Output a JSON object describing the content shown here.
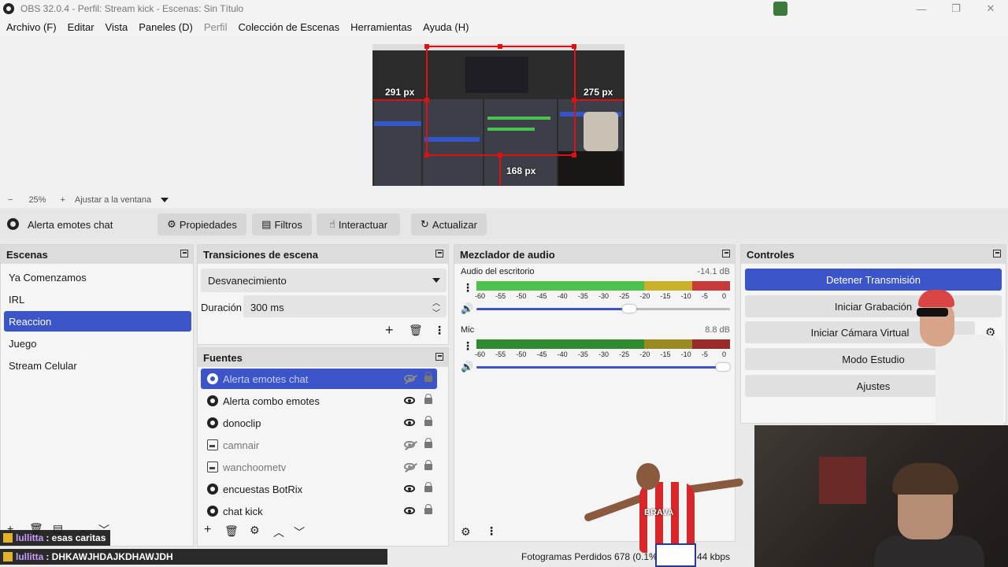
{
  "window": {
    "title": "OBS 32.0.4 - Perfil: Stream kick - Escenas: Sin Título",
    "controls": [
      "—",
      "❐",
      "✕"
    ]
  },
  "menu": [
    "Archivo (F)",
    "Editar",
    "Vista",
    "Paneles (D)",
    "Perfil",
    "Colección de Escenas",
    "Herramientas",
    "Ayuda (H)"
  ],
  "preview": {
    "labels": [
      "291 px",
      "275 px",
      "168 px"
    ]
  },
  "zoom": {
    "minus": "−",
    "level": "25%",
    "plus": "+",
    "fit": "Ajustar a la ventana"
  },
  "source_bar": {
    "current_source": "Alerta emotes chat",
    "properties": "Propiedades",
    "filters": "Filtros",
    "interact": "Interactuar",
    "refresh": "Actualizar"
  },
  "scenes": {
    "title": "Escenas",
    "items": [
      "Ya Comenzamos",
      "IRL",
      "Reaccion",
      "Juego",
      "Stream Celular"
    ],
    "selected_index": 2
  },
  "transitions": {
    "title": "Transiciones de escena",
    "selected": "Desvanecimiento",
    "duration_label": "Duración",
    "duration_value": "300 ms"
  },
  "sources": {
    "title": "Fuentes",
    "items": [
      {
        "label": "Alerta emotes chat",
        "type": "browser",
        "visible": false,
        "selected": true
      },
      {
        "label": "Alerta combo emotes",
        "type": "browser",
        "visible": true,
        "selected": false
      },
      {
        "label": "donoclip",
        "type": "browser",
        "visible": true,
        "selected": false
      },
      {
        "label": "camnair",
        "type": "image",
        "visible": false,
        "selected": false
      },
      {
        "label": "wanchoometv",
        "type": "image",
        "visible": false,
        "selected": false
      },
      {
        "label": "encuestas BotRix",
        "type": "browser",
        "visible": true,
        "selected": false
      },
      {
        "label": "chat kick",
        "type": "browser",
        "visible": true,
        "selected": false
      }
    ]
  },
  "mixer": {
    "title": "Mezclador de audio",
    "channels": [
      {
        "name": "Audio del escritorio",
        "db": "-14.1 dB",
        "volume": 0.63
      },
      {
        "name": "Mic",
        "db": "8.8 dB",
        "volume": 1.0
      }
    ],
    "scale": [
      "-60",
      "-55",
      "-50",
      "-45",
      "-40",
      "-35",
      "-30",
      "-25",
      "-20",
      "-15",
      "-10",
      "-5",
      "0"
    ]
  },
  "controls": {
    "title": "Controles",
    "buttons": [
      "Detener Transmisión",
      "Iniciar Grabación",
      "Iniciar Cámara Virtual",
      "Modo Estudio",
      "Ajustes"
    ]
  },
  "chat": [
    {
      "user": "lullitta",
      "message": ": esas caritas"
    },
    {
      "user": "lullitta",
      "message": ": DHKAWJHDAJKDHAWJDH"
    }
  ],
  "status": {
    "dropped": "Fotogramas Perdidos 678 (0.1%",
    "kbps": "44 kbps"
  },
  "overlay": {
    "jersey": "BRAVA"
  },
  "colors": {
    "accent": "#3b55c9",
    "meter_green": "#4cc24c",
    "meter_yellow": "#c9b22a",
    "meter_red": "#c83a3a"
  }
}
